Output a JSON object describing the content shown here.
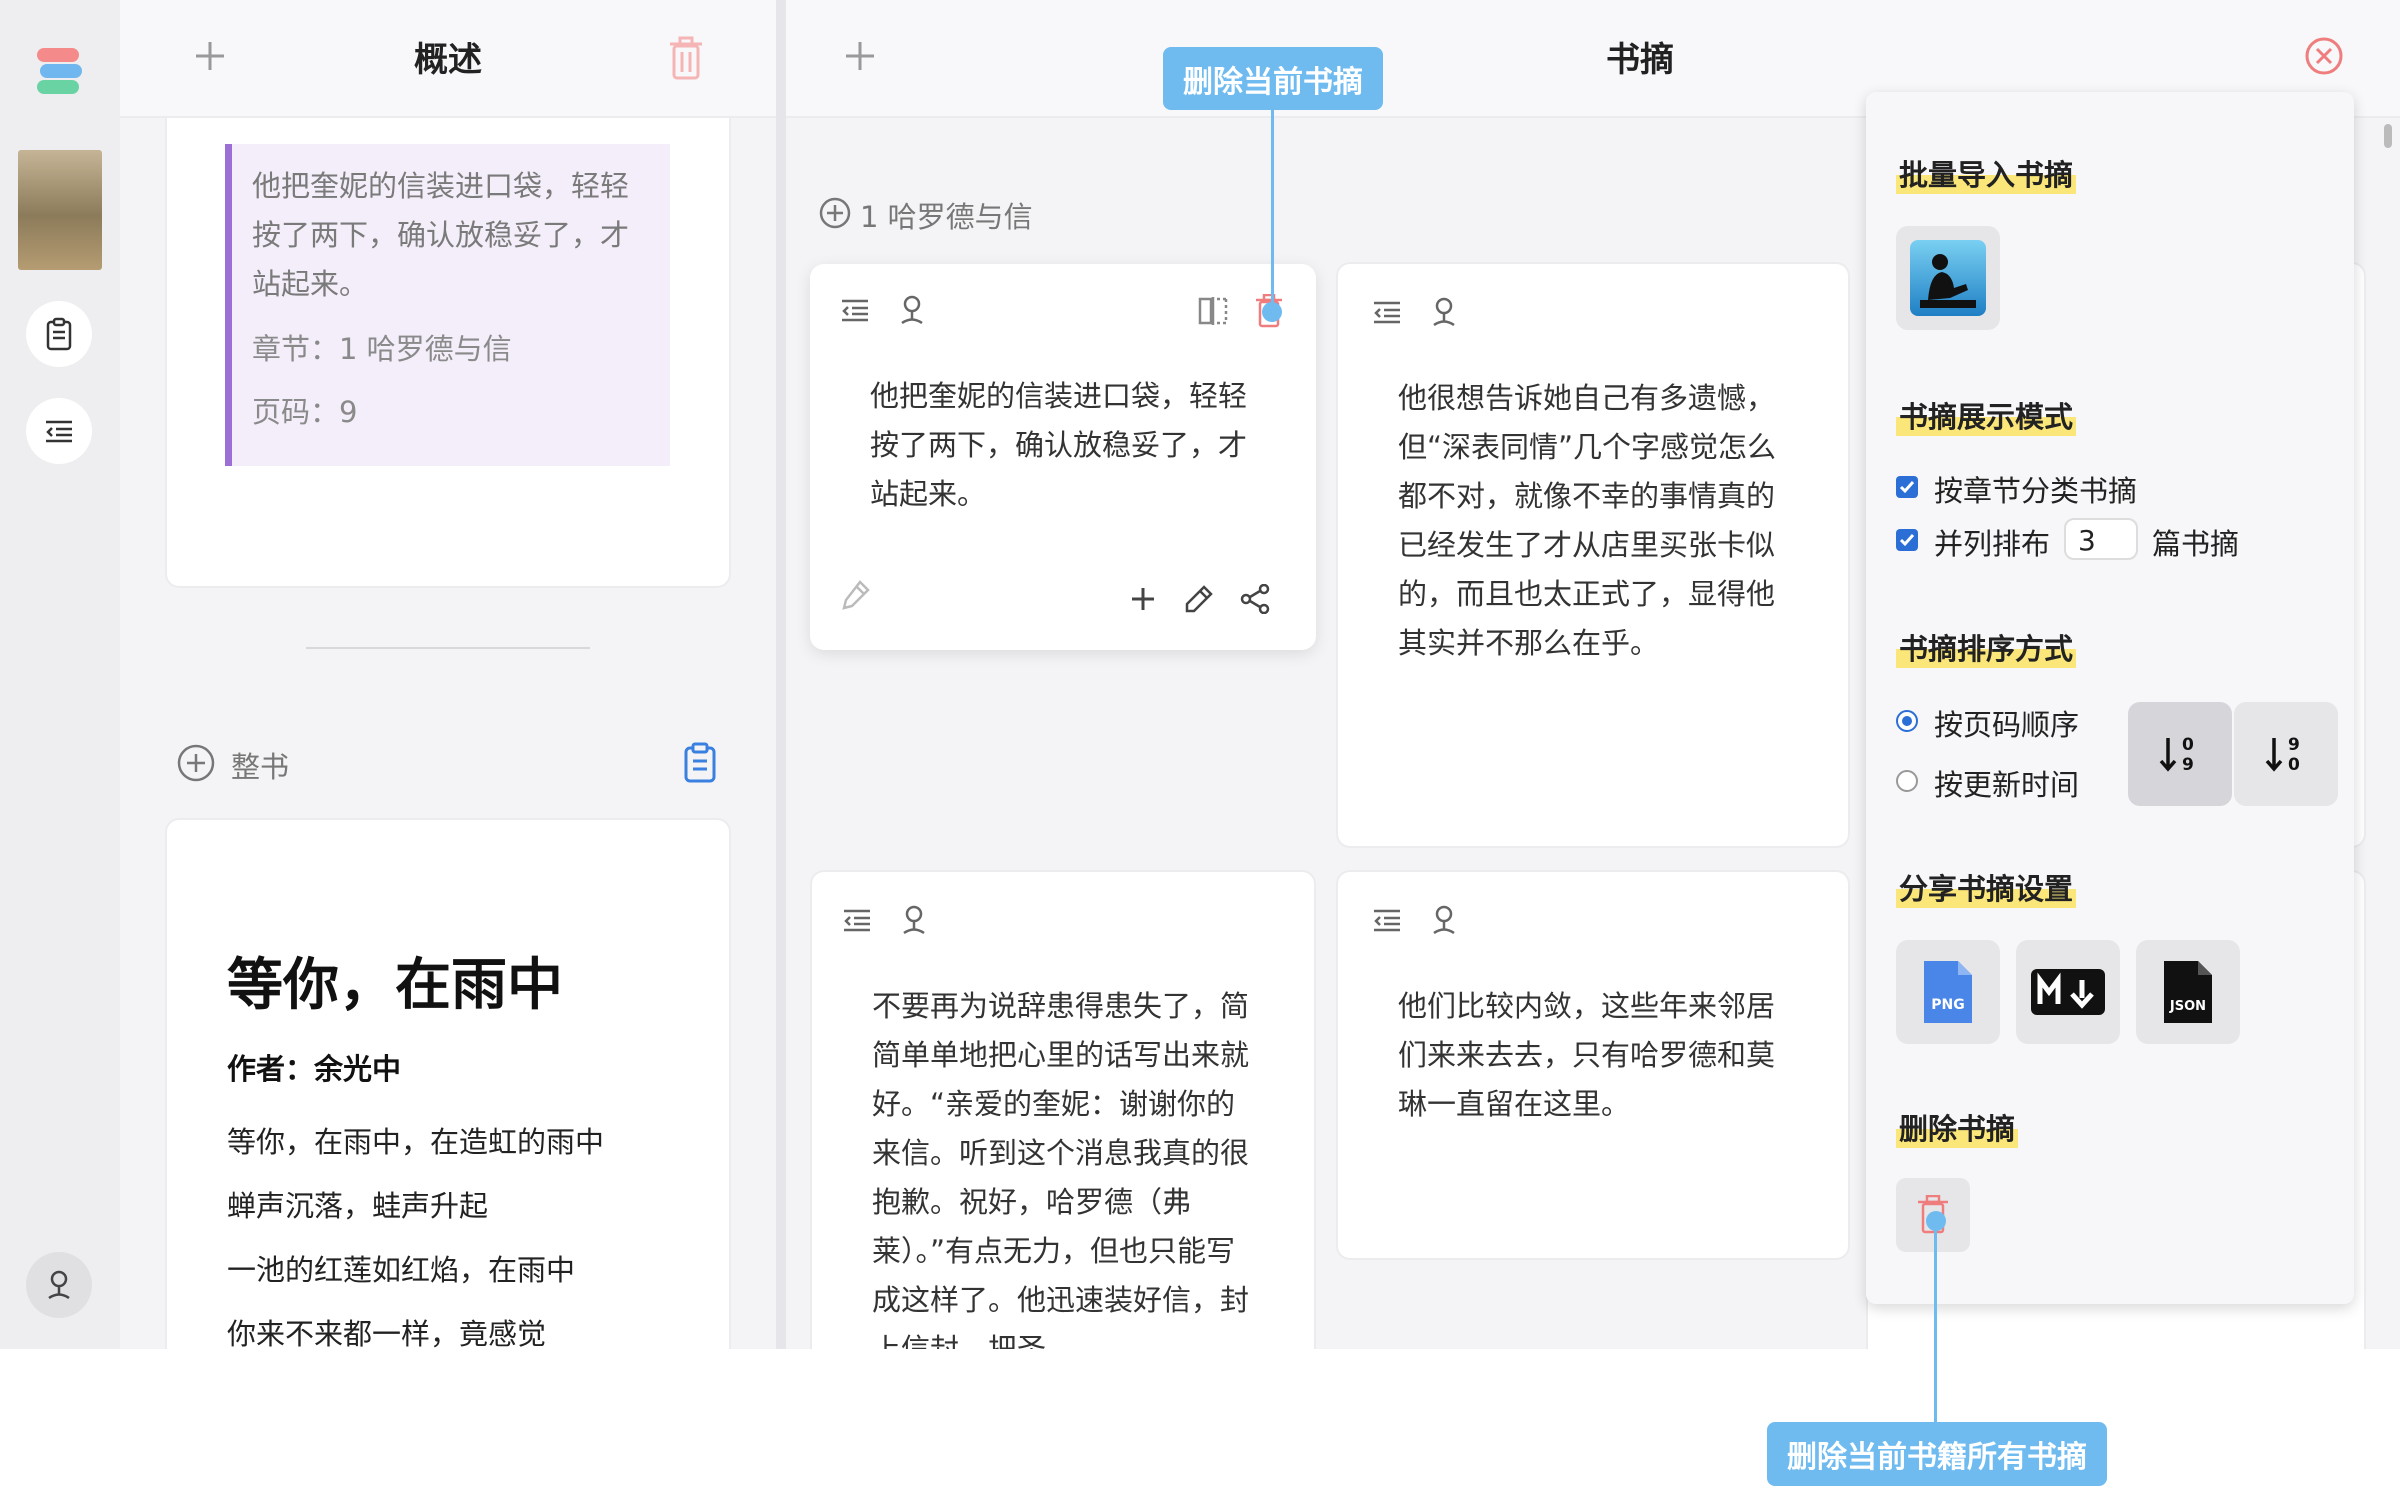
{
  "left_panel": {
    "header_title": "概述",
    "highlight": {
      "quote": "他把奎妮的信装进口袋，轻轻按了两下，确认放稳妥了，才站起来。",
      "chapter_line": "章节：1 哈罗德与信",
      "page_line": "页码：9"
    },
    "whole_book_label": "整书",
    "poem": {
      "title": "等你，在雨中",
      "author": "作者：余光中",
      "lines": [
        "等你，在雨中，在造虹的雨中",
        "蝉声沉落，蛙声升起",
        "一池的红莲如红焰，在雨中",
        "你来不来都一样，竟感觉"
      ]
    }
  },
  "excerpts_panel": {
    "header_title": "书摘",
    "chapter_label": "1 哈罗德与信",
    "cards": [
      {
        "text": "他把奎妮的信装进口袋，轻轻按了两下，确认放稳妥了，才站起来。"
      },
      {
        "text": "他很想告诉她自己有多遗憾，但“深表同情”几个字感觉怎么都不对，就像不幸的事情真的已经发生了才从店里买张卡似的，而且也太正式了，显得他其实并不那么在乎。"
      },
      {
        "text": "不要再为说辞患得患失了，简简单单地把心里的话写出来就好。“亲爱的奎妮：谢谢你的来信。听到这个消息我真的很抱歉。祝好，哈罗德（弗莱）。”有点无力，但也只能写成这样了。他迅速装好信，封上信封，把圣"
      },
      {
        "text": "他们比较内敛，这些年来邻居们来来去去，只有哈罗德和莫琳一直留在这里。"
      }
    ]
  },
  "settings_panel": {
    "import_title": "批量导入书摘",
    "display_title": "书摘展示模式",
    "by_chapter_label": "按章节分类书摘",
    "columns_label": "并列排布",
    "columns_value": "3",
    "columns_suffix": "篇书摘",
    "sort_title": "书摘排序方式",
    "sort_page_label": "按页码顺序",
    "sort_time_label": "按更新时间",
    "share_title": "分享书摘设置",
    "share_png": "PNG",
    "share_json": "JSON",
    "delete_title": "删除书摘"
  },
  "callouts": {
    "top": "删除当前书摘",
    "bottom": "删除当前书籍所有书摘"
  },
  "colors": {
    "accent": "#6fbbf0",
    "highlight_bar": "#9c6fd6",
    "delete_red": "#f08a8a",
    "title_underline": "#fbe67a"
  }
}
